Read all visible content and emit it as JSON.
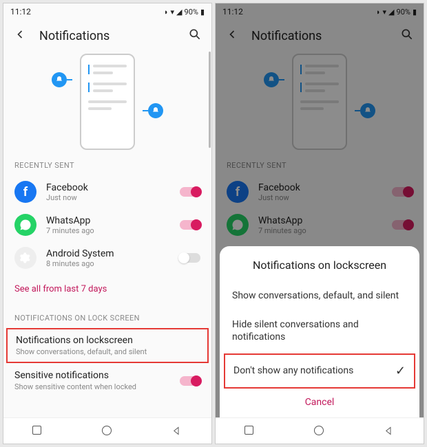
{
  "status": {
    "time": "11:12",
    "battery_pct": "90%"
  },
  "header": {
    "title": "Notifications"
  },
  "sections": {
    "recently_sent": "RECENTLY SENT",
    "lock_screen": "NOTIFICATIONS ON LOCK SCREEN"
  },
  "apps": [
    {
      "name": "Facebook",
      "time": "Just now",
      "toggle": true
    },
    {
      "name": "WhatsApp",
      "time": "7 minutes ago",
      "toggle": true
    },
    {
      "name": "Android System",
      "time": "8 minutes ago",
      "toggle": false
    }
  ],
  "see_all": "See all from last 7 days",
  "settings": {
    "lockscreen": {
      "title": "Notifications on lockscreen",
      "sub": "Show conversations, default, and silent"
    },
    "sensitive": {
      "title": "Sensitive notifications",
      "sub": "Show sensitive content when locked"
    }
  },
  "dialog": {
    "title": "Notifications on lockscreen",
    "options": [
      "Show conversations, default, and silent",
      "Hide silent conversations and notifications",
      "Don't show any notifications"
    ],
    "cancel": "Cancel"
  }
}
